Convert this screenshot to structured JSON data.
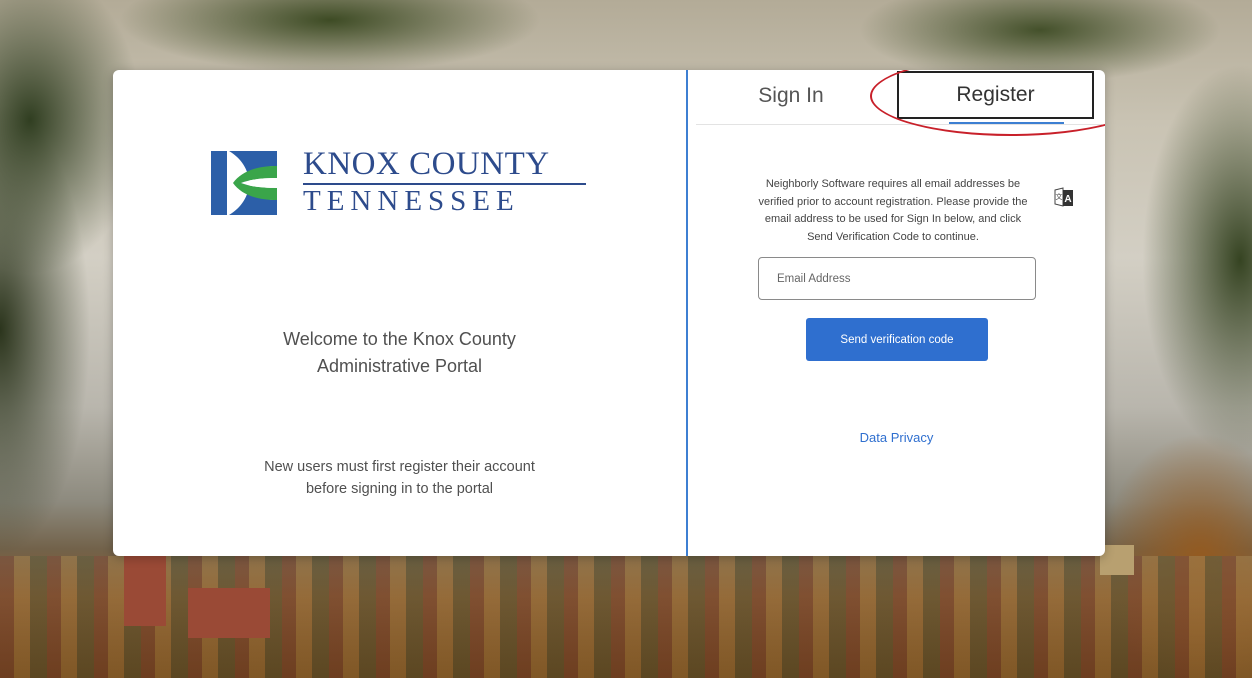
{
  "branding": {
    "logo_line_1": "KNOX COUNTY",
    "logo_line_2": "TENNESSEE",
    "colors": {
      "navy": "#2d4b8c",
      "blue": "#2c5fa8",
      "green": "#3aa54a"
    }
  },
  "left_panel": {
    "welcome_line_1": "Welcome to the Knox County",
    "welcome_line_2": "Administrative Portal",
    "new_users_line_1": "New users must first register their account",
    "new_users_line_2": "before signing in to the portal"
  },
  "tabs": [
    {
      "label": "Sign In",
      "active": false
    },
    {
      "label": "Register",
      "active": true
    }
  ],
  "register": {
    "info_line_1": "Neighborly Software requires all email addresses be",
    "info_line_2": "verified prior to account registration. Please provide the",
    "info_line_3": "email address to be used for Sign In below, and click",
    "info_line_4": "Send Verification Code to continue.",
    "email_placeholder": "Email Address",
    "email_value": "",
    "send_button_label": "Send verification code",
    "privacy_link": "Data Privacy"
  },
  "icons": {
    "translate": "translate-icon",
    "logo_mark": "knox-county-logo-mark"
  },
  "theme": {
    "accent": "#2f6fcf",
    "divider": "#3d7fd2",
    "annotation": "#c8202a"
  }
}
